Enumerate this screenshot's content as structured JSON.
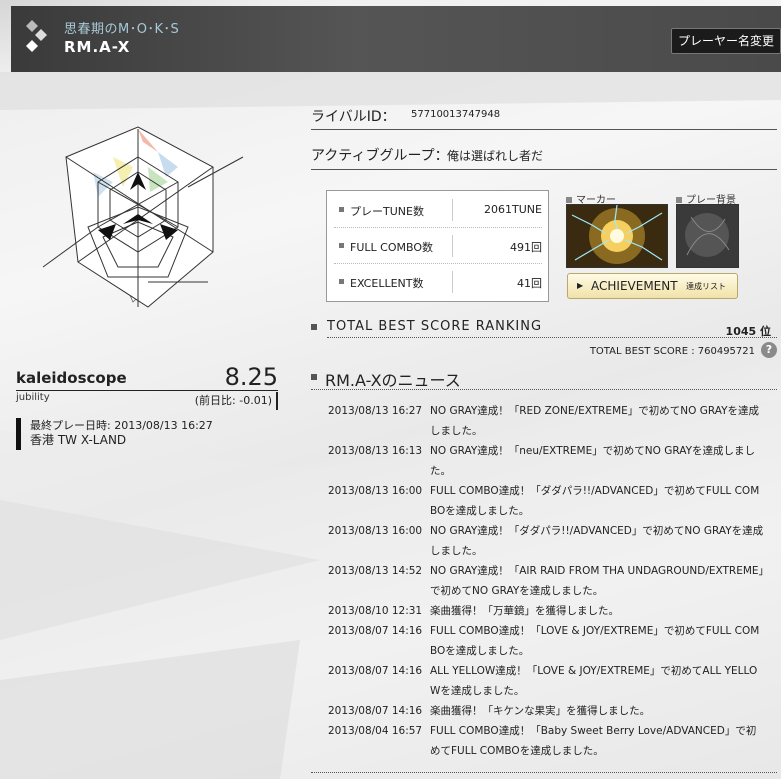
{
  "header": {
    "subtitle": "思春期のM･O･K･S",
    "player_name": "RM.A-X",
    "change_name_button": "プレーヤー名変更"
  },
  "player": {
    "title": "kaleidoscope",
    "jubility_label": "jubility",
    "jubility_value": "8.25",
    "jubility_diff": "(前日比: -0.01)",
    "last_play": "最終プレー日時: 2013/08/13 16:27",
    "location": "香港 TW  X-LAND"
  },
  "rival": {
    "label": "ライバルID：",
    "value": "57710013747948"
  },
  "group": {
    "label": "アクティブグループ：",
    "value": "俺は選ばれし者だ"
  },
  "stats": [
    {
      "label": "プレーTUNE数",
      "value": "2061TUNE"
    },
    {
      "label": "FULL COMBO数",
      "value": "491回"
    },
    {
      "label": "EXCELLENT数",
      "value": "41回"
    }
  ],
  "marker_label": "マーカー",
  "background_label": "プレー背景",
  "achievement": {
    "label": "ACHIEVEMENT",
    "sub": "達成リスト"
  },
  "ranking": {
    "title": "TOTAL BEST SCORE RANKING",
    "rank": "1045 位",
    "best_score": "TOTAL BEST SCORE : 760495721",
    "help": "?"
  },
  "news_title": "RM.A-Xのニュース",
  "news": [
    {
      "date": "2013/08/13 16:27",
      "text": "NO GRAY達成！「RED ZONE/EXTREME」で初めてNO GRAYを達成しました。"
    },
    {
      "date": "2013/08/13 16:13",
      "text": "NO GRAY達成！「neu/EXTREME」で初めてNO GRAYを達成しました。"
    },
    {
      "date": "2013/08/13 16:00",
      "text": "FULL COMBO達成！「ダダパラ!!/ADVANCED」で初めてFULL COMBOを達成しました。"
    },
    {
      "date": "2013/08/13 16:00",
      "text": "NO GRAY達成！「ダダパラ!!/ADVANCED」で初めてNO GRAYを達成しました。"
    },
    {
      "date": "2013/08/13 14:52",
      "text": "NO GRAY達成！「AIR RAID FROM THA UNDAGROUND/EXTREME」で初めてNO GRAYを達成しました。"
    },
    {
      "date": "2013/08/10 12:31",
      "text": "楽曲獲得！「万華鏡」を獲得しました。"
    },
    {
      "date": "2013/08/07 14:16",
      "text": "FULL COMBO達成！「LOVE & JOY/EXTREME」で初めてFULL COMBOを達成しました。"
    },
    {
      "date": "2013/08/07 14:16",
      "text": "ALL YELLOW達成！「LOVE & JOY/EXTREME」で初めてALL YELLOWを達成しました。"
    },
    {
      "date": "2013/08/07 14:16",
      "text": "楽曲獲得！「キケンな果実」を獲得しました。"
    },
    {
      "date": "2013/08/04 16:57",
      "text": "FULL COMBO達成！「Baby Sweet Berry Love/ADVANCED」で初めてFULL COMBOを達成しました。"
    }
  ]
}
